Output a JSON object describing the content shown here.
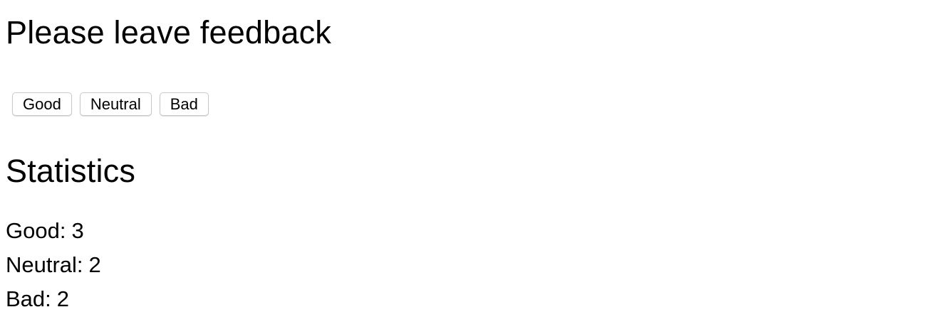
{
  "feedback": {
    "title": "Please leave feedback",
    "buttons": [
      {
        "label": "Good"
      },
      {
        "label": "Neutral"
      },
      {
        "label": "Bad"
      }
    ]
  },
  "statistics": {
    "title": "Statistics",
    "items": [
      {
        "label": "Good:",
        "value": "3"
      },
      {
        "label": "Neutral:",
        "value": "2"
      },
      {
        "label": "Bad:",
        "value": "2"
      }
    ]
  },
  "colors": {
    "background": "#ffffff",
    "text": "#000000",
    "button_border": "#c9c9c9"
  }
}
